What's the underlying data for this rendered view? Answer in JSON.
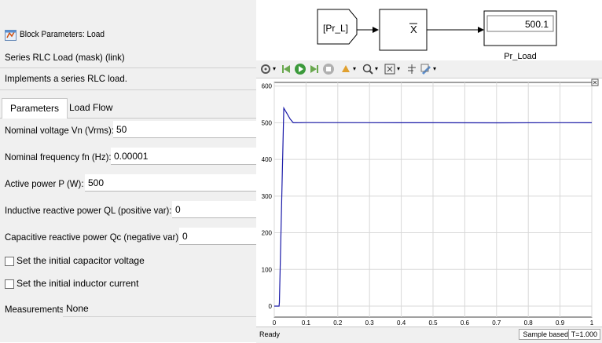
{
  "dialog": {
    "title": "Block Parameters: Load",
    "mask_line": "Series RLC Load (mask) (link)",
    "description": "Implements a series RLC load.",
    "tabs": [
      {
        "label": "Parameters",
        "active": true
      },
      {
        "label": "Load Flow",
        "active": false
      }
    ],
    "params": {
      "vn": {
        "label": "Nominal voltage Vn (Vrms):",
        "value": "50"
      },
      "fn": {
        "label": "Nominal frequency fn (Hz):",
        "value": "0.00001"
      },
      "p": {
        "label": "Active power P (W):",
        "value": "500"
      },
      "ql": {
        "label": "Inductive reactive power QL (positive var):",
        "value": "0"
      },
      "qc": {
        "label": "Capacitive reactive power Qc (negative var):",
        "value": "0"
      }
    },
    "checks": {
      "cap_init": {
        "label": "Set the initial capacitor voltage",
        "checked": false
      },
      "ind_init": {
        "label": "Set the initial inductor current",
        "checked": false
      }
    },
    "measurements": {
      "label": "Measurements",
      "value": "None"
    }
  },
  "diagram": {
    "goto_tag": "[Pr_L]",
    "display_value": "500.1",
    "display_label": "Pr_Load"
  },
  "scope": {
    "toolbar_icons": [
      "settings-icon",
      "step-back-icon",
      "run-icon",
      "step-forward-icon",
      "stop-icon",
      "highlight-icon",
      "zoom-icon",
      "fit-icon",
      "cursor-icon",
      "style-icon"
    ],
    "status": {
      "ready": "Ready",
      "mode": "Sample based",
      "time": "T=1.000"
    }
  },
  "chart_data": {
    "type": "line",
    "x_ticks": [
      "0",
      "0.1",
      "0.2",
      "0.3",
      "0.4",
      "0.5",
      "0.6",
      "0.7",
      "0.8",
      "0.9",
      "1"
    ],
    "y_ticks": [
      "0",
      "100",
      "200",
      "300",
      "400",
      "500",
      "600"
    ],
    "xlim": [
      0,
      1
    ],
    "ylim": [
      -30,
      610
    ],
    "grid": true,
    "series": [
      {
        "color": "#1a1aa8",
        "x": [
          0,
          0.015,
          0.016,
          0.03,
          0.04,
          0.05,
          0.06,
          0.07,
          0.1,
          0.3,
          0.5,
          0.7,
          0.9,
          1.0
        ],
        "y": [
          0,
          0,
          10,
          540,
          525,
          510,
          500,
          500,
          500.5,
          500.2,
          500,
          499.8,
          500.1,
          500
        ]
      }
    ]
  }
}
